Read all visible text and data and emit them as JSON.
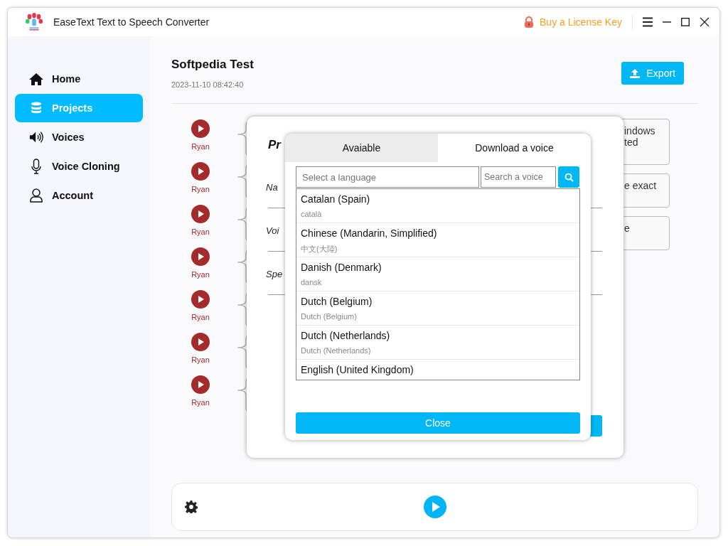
{
  "app": {
    "title": "EaseText Text to Speech Converter",
    "license_link": "Buy a License Key"
  },
  "sidebar": {
    "items": [
      {
        "label": "Home",
        "kind": "home",
        "selected": false
      },
      {
        "label": "Projects",
        "kind": "projects",
        "selected": true
      },
      {
        "label": "Voices",
        "kind": "voices",
        "selected": false
      },
      {
        "label": "Voice Cloning",
        "kind": "cloning",
        "selected": false
      },
      {
        "label": "Account",
        "kind": "account",
        "selected": false
      }
    ]
  },
  "project": {
    "title": "Softpedia Test",
    "date": "2023-11-10 08:42:40",
    "export_button": "Export"
  },
  "segments": [
    {
      "voice": "Ryan"
    },
    {
      "voice": "Ryan"
    },
    {
      "voice": "Ryan"
    },
    {
      "voice": "Ryan"
    },
    {
      "voice": "Ryan"
    },
    {
      "voice": "Ryan"
    },
    {
      "voice": "Ryan"
    }
  ],
  "segment_texts": [
    {
      "lines": [
        "indows",
        "ted"
      ]
    },
    {
      "lines": [
        "e exact"
      ]
    },
    {
      "lines": [
        "e"
      ]
    }
  ],
  "project_dialog": {
    "title": "Pr",
    "fields": [
      "Na",
      "Voi",
      "Spe"
    ]
  },
  "voice_dialog": {
    "tabs": [
      {
        "label": "Avaiable",
        "selected": false
      },
      {
        "label": "Download a voice",
        "selected": true
      }
    ],
    "language_placeholder": "Select a language",
    "voice_placeholder": "Search a voice",
    "languages": [
      {
        "name": "Catalan (Spain)",
        "native": "català"
      },
      {
        "name": "Chinese (Mandarin, Simplified)",
        "native": "中文(大陸)"
      },
      {
        "name": "Danish (Denmark)",
        "native": "dansk"
      },
      {
        "name": "Dutch (Belgium)",
        "native": "Dutch (Belgium)"
      },
      {
        "name": "Dutch (Netherlands)",
        "native": "Dutch (Netherlands)"
      },
      {
        "name": "English (United Kingdom)"
      }
    ],
    "close_button": "Close"
  }
}
